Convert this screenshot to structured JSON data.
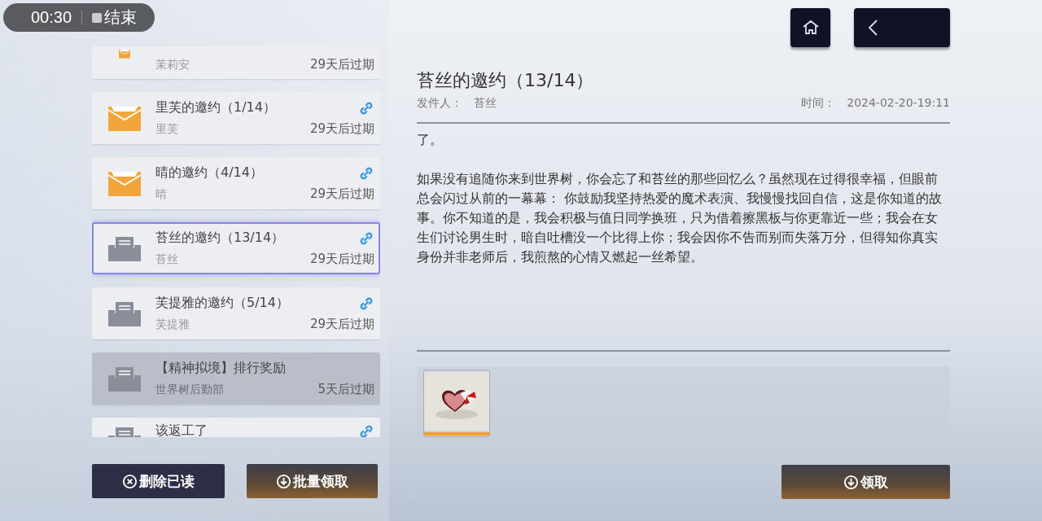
{
  "recorder": {
    "time": "00:30",
    "stop_label": "结束"
  },
  "mails": [
    {
      "sender": "茉莉安",
      "expiry": "29天后过期",
      "read": false,
      "selected": false,
      "disabled": false
    },
    {
      "title": "里芙的邀约（1/14）",
      "sender": "里芙",
      "expiry": "29天后过期",
      "read": false,
      "attachment": true,
      "selected": false,
      "disabled": false
    },
    {
      "title": "晴的邀约（4/14）",
      "sender": "晴",
      "expiry": "29天后过期",
      "read": false,
      "attachment": true,
      "selected": false,
      "disabled": false
    },
    {
      "title": "苔丝的邀约（13/14）",
      "sender": "苔丝",
      "expiry": "29天后过期",
      "read": true,
      "attachment": true,
      "selected": true,
      "disabled": false
    },
    {
      "title": "芙提雅的邀约（5/14）",
      "sender": "芙提雅",
      "expiry": "29天后过期",
      "read": true,
      "attachment": true,
      "selected": false,
      "disabled": false
    },
    {
      "title": "【精神拟境】排行奖励",
      "sender": "世界树后勤部",
      "expiry": "5天后过期",
      "read": true,
      "attachment": false,
      "selected": false,
      "disabled": true
    },
    {
      "title": "该返工了",
      "read": true,
      "attachment": true,
      "selected": false,
      "disabled": false
    }
  ],
  "list_buttons": [
    {
      "label": "删除已读",
      "kind": "delete"
    },
    {
      "label": "批量领取",
      "kind": "claim"
    }
  ],
  "detail": {
    "title": "苔丝的邀约（13/14）",
    "sender_label": "发件人：",
    "sender": "苔丝",
    "time_label": "时间：",
    "time": "2024-02-20-19:11",
    "paragraphs": [
      "了。",
      "如果没有追随你来到世界树，你会忘了和苔丝的那些回忆么？虽然现在过得很幸福，但眼前总会闪过从前的一幕幕： 你鼓励我坚持热爱的魔术表演、我慢慢找回自信，这是你知道的故事。你不知道的是，我会积极与值日同学换班，只为借着擦黑板与你更靠近一些；我会在女生们讨论男生时，暗自吐槽没一个比得上你；我会因你不告而别而失落万分，但得知你真实身份并非老师后，我煎熬的心情又燃起一丝希望。"
    ],
    "claim_button": {
      "label": "领取",
      "kind": "claim"
    }
  }
}
